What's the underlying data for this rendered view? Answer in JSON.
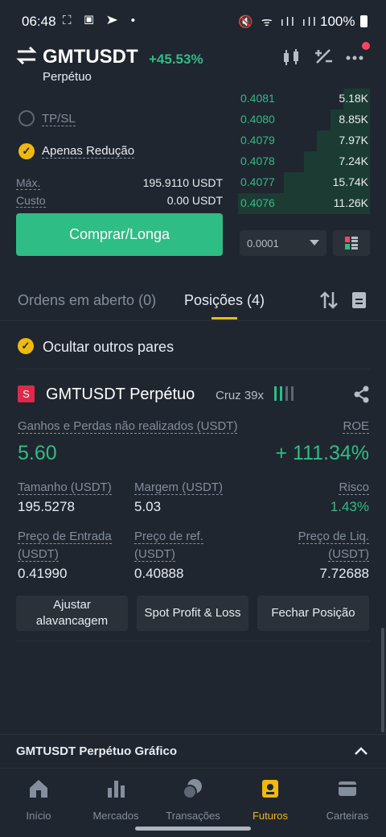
{
  "status_bar": {
    "time": "06:48",
    "battery": "100%"
  },
  "header": {
    "symbol": "GMTUSDT",
    "change": "+45.53%",
    "contract_type": "Perpétuo"
  },
  "order_form": {
    "tpsl_label": "TP/SL",
    "reduce_only_label": "Apenas Redução",
    "max_label": "Máx.",
    "max_value": "195.9110 USDT",
    "cost_label": "Custo",
    "cost_value": "0.00 USDT",
    "buy_button": "Comprar/Longa"
  },
  "orderbook": {
    "rows": [
      {
        "price": "0.4081",
        "qty": "5.18K",
        "depth": 0.2
      },
      {
        "price": "0.4080",
        "qty": "8.85K",
        "depth": 0.3
      },
      {
        "price": "0.4079",
        "qty": "7.97K",
        "depth": 0.4
      },
      {
        "price": "0.4078",
        "qty": "7.24K",
        "depth": 0.5
      },
      {
        "price": "0.4077",
        "qty": "15.74K",
        "depth": 0.65
      },
      {
        "price": "0.4076",
        "qty": "11.26K",
        "depth": 1.0
      }
    ],
    "precision": "0.0001"
  },
  "tabs": {
    "open_orders": "Ordens em aberto (0)",
    "positions": "Posições (4)"
  },
  "hide_other_pairs": "Ocultar outros pares",
  "position": {
    "badge": "S",
    "title": "GMTUSDT Perpétuo",
    "margin_mode": "Cruz 39x",
    "unrealized_label": "Ganhos e Perdas não realizados (USDT)",
    "unrealized_value": "5.60",
    "roe_label": "ROE",
    "roe_value": "+ 111.34%",
    "size_label": "Tamanho (USDT)",
    "size_value": "195.5278",
    "margin_label": "Margem (USDT)",
    "margin_value": "5.03",
    "risk_label": "Risco",
    "risk_value": "1.43%",
    "entry_label_1": "Preço de Entrada",
    "entry_label_2": "(USDT)",
    "entry_value": "0.41990",
    "ref_label_1": "Preço de ref.",
    "ref_label_2": "(USDT)",
    "ref_value": "0.40888",
    "liq_label_1": "Preço de Liq.",
    "liq_label_2": "(USDT)",
    "liq_value": "7.72688",
    "adjust_leverage_1": "Ajustar",
    "adjust_leverage_2": "alavancagem",
    "spot_pnl": "Spot Profit & Loss",
    "close_position": "Fechar Posição"
  },
  "chart_bar": {
    "label": "GMTUSDT Perpétuo  Gráfico"
  },
  "nav": {
    "items": [
      {
        "label": "Início",
        "icon": "home-icon"
      },
      {
        "label": "Mercados",
        "icon": "markets-icon"
      },
      {
        "label": "Transações",
        "icon": "trade-icon"
      },
      {
        "label": "Futuros",
        "icon": "futures-icon"
      },
      {
        "label": "Carteiras",
        "icon": "wallet-icon"
      }
    ],
    "active": "Futuros"
  },
  "colors": {
    "green": "#2ebd85",
    "yellow": "#f0b90b",
    "red": "#f6465d",
    "background": "#1f2630"
  }
}
